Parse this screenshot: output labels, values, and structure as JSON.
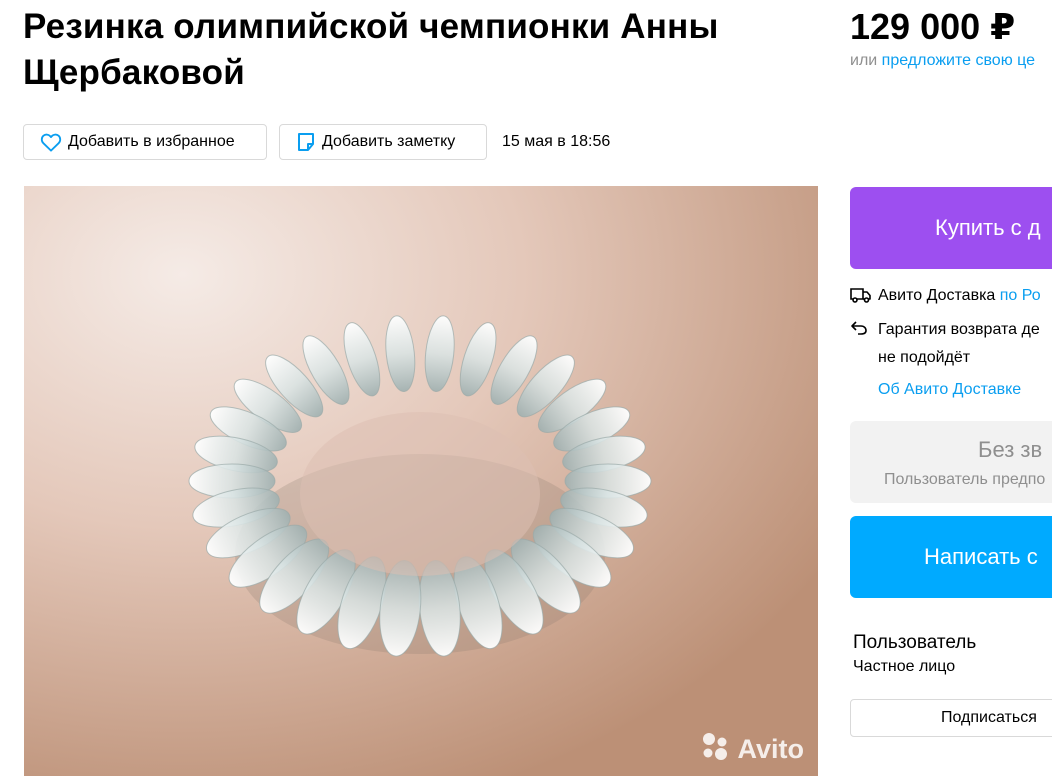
{
  "listing": {
    "title": "Резинка олимпийской чемпионки Анны Щербаковой",
    "price": "129 000 ₽",
    "offer_prefix": "или",
    "offer_link": "предложите свою це",
    "date": "15 мая в 18:56"
  },
  "toolbar": {
    "favorite_label": "Добавить в избранное",
    "note_label": "Добавить заметку"
  },
  "photo": {
    "watermark": "Avito"
  },
  "sidebar": {
    "buy_label": "Купить с д",
    "delivery_label": "Авито Доставка",
    "delivery_link": "по Ро",
    "guarantee_line1": "Гарантия возврата де",
    "guarantee_line2": "не подойдёт",
    "about_delivery_link": "Об Авито Доставке",
    "rating_title": "Без зв",
    "rating_sub": "Пользователь предпо",
    "write_label": "Написать с",
    "seller_name": "Пользователь",
    "seller_type": "Частное лицо",
    "subscribe_label": "Подписаться"
  },
  "colors": {
    "buy_button": "#9d4ff0",
    "write_button": "#00aaff",
    "link": "#0a9ef0"
  }
}
